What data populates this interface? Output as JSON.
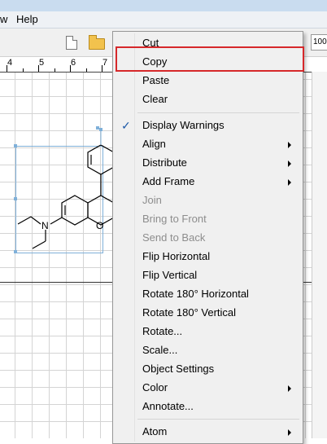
{
  "menubar": {
    "view_fragment": "w",
    "help": "Help"
  },
  "toolbar": {
    "zoom": "100"
  },
  "ruler": {
    "labels": [
      "4",
      "5",
      "6",
      "7"
    ]
  },
  "context_menu": {
    "items": [
      {
        "label": "Cut",
        "disabled": false,
        "submenu": false
      },
      {
        "label": "Copy",
        "disabled": false,
        "submenu": false,
        "highlighted": true
      },
      {
        "label": "Paste",
        "disabled": false,
        "submenu": false
      },
      {
        "label": "Clear",
        "disabled": false,
        "submenu": false
      },
      {
        "label": "Display Warnings",
        "disabled": false,
        "submenu": false,
        "checked": true
      },
      {
        "label": "Align",
        "disabled": false,
        "submenu": true
      },
      {
        "label": "Distribute",
        "disabled": false,
        "submenu": true
      },
      {
        "label": "Add Frame",
        "disabled": false,
        "submenu": true
      },
      {
        "label": "Join",
        "disabled": true,
        "submenu": false
      },
      {
        "label": "Bring to Front",
        "disabled": true,
        "submenu": false
      },
      {
        "label": "Send to Back",
        "disabled": true,
        "submenu": false
      },
      {
        "label": "Flip Horizontal",
        "disabled": false,
        "submenu": false
      },
      {
        "label": "Flip Vertical",
        "disabled": false,
        "submenu": false
      },
      {
        "label": "Rotate 180° Horizontal",
        "disabled": false,
        "submenu": false
      },
      {
        "label": "Rotate 180° Vertical",
        "disabled": false,
        "submenu": false
      },
      {
        "label": "Rotate...",
        "disabled": false,
        "submenu": false
      },
      {
        "label": "Scale...",
        "disabled": false,
        "submenu": false
      },
      {
        "label": "Object Settings",
        "disabled": false,
        "submenu": false
      },
      {
        "label": "Color",
        "disabled": false,
        "submenu": true
      },
      {
        "label": "Annotate...",
        "disabled": false,
        "submenu": false
      },
      {
        "label": "Atom",
        "disabled": false,
        "submenu": true
      }
    ]
  },
  "molecule": {
    "atom_n": "N",
    "atom_o": "O"
  },
  "colors": {
    "highlight_border": "#d6282b",
    "selection": "#7fb0d9",
    "check": "#1e5aa8"
  }
}
